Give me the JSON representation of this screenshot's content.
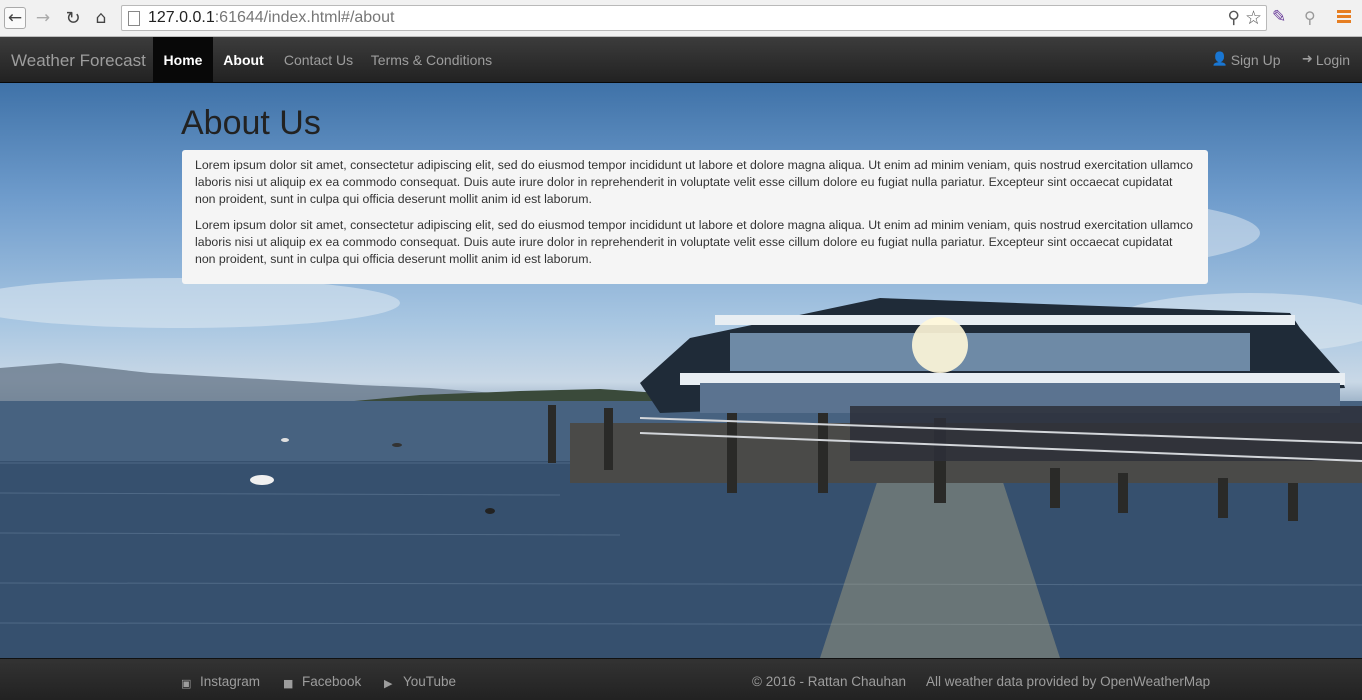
{
  "browser": {
    "url_host": "127.0.0.1",
    "url_rest": ":61644/index.html#/about"
  },
  "navbar": {
    "brand": "Weather Forecast",
    "items": [
      {
        "label": "Home"
      },
      {
        "label": "About"
      },
      {
        "label": "Contact Us"
      },
      {
        "label": "Terms & Conditions"
      }
    ],
    "right": [
      {
        "label": "Sign Up",
        "icon": "user-icon"
      },
      {
        "label": "Login",
        "icon": "login-icon"
      }
    ],
    "active": "Home"
  },
  "main": {
    "title": "About Us",
    "paragraphs": [
      "Lorem ipsum dolor sit amet, consectetur adipiscing elit, sed do eiusmod tempor incididunt ut labore et dolore magna aliqua. Ut enim ad minim veniam, quis nostrud exercitation ullamco laboris nisi ut aliquip ex ea commodo consequat. Duis aute irure dolor in reprehenderit in voluptate velit esse cillum dolore eu fugiat nulla pariatur. Excepteur sint occaecat cupidatat non proident, sunt in culpa qui officia deserunt mollit anim id est laborum.",
      "Lorem ipsum dolor sit amet, consectetur adipiscing elit, sed do eiusmod tempor incididunt ut labore et dolore magna aliqua. Ut enim ad minim veniam, quis nostrud exercitation ullamco laboris nisi ut aliquip ex ea commodo consequat. Duis aute irure dolor in reprehenderit in voluptate velit esse cillum dolore eu fugiat nulla pariatur. Excepteur sint occaecat cupidatat non proident, sunt in culpa qui officia deserunt mollit anim id est laborum."
    ]
  },
  "footer": {
    "links": [
      {
        "label": "Instagram",
        "icon": "instagram-icon"
      },
      {
        "label": "Facebook",
        "icon": "facebook-icon"
      },
      {
        "label": "YouTube",
        "icon": "youtube-icon"
      }
    ],
    "copyright": "© 2016 - Rattan Chauhan",
    "attribution": "All weather data provided by OpenWeatherMap"
  },
  "colors": {
    "navbar_bg": "#222222",
    "active_nav_bg": "#080808",
    "panel_bg": "#f5f5f5"
  }
}
